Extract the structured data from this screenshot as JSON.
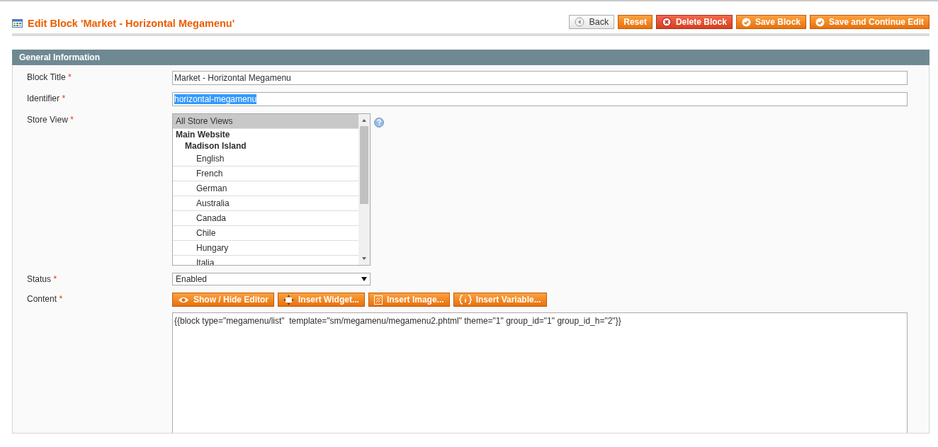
{
  "page_title": "Edit Block 'Market - Horizontal Megamenu'",
  "header_buttons": [
    {
      "kind": "back",
      "label": "Back"
    },
    {
      "kind": "plain",
      "label": "Reset"
    },
    {
      "kind": "delete",
      "label": "Delete Block"
    },
    {
      "kind": "save",
      "label": "Save Block"
    },
    {
      "kind": "save",
      "label": "Save and Continue Edit"
    }
  ],
  "section_title": "General Information",
  "fields": {
    "block_title": {
      "label": "Block Title",
      "required_mark": "*",
      "value": "Market - Horizontal Megamenu"
    },
    "identifier": {
      "label": "Identifier",
      "required_mark": "*",
      "value": "horizontal-megamenu",
      "text_selected": true
    },
    "store_view": {
      "label": "Store View",
      "required_mark": "*",
      "options": [
        {
          "label": "All Store Views",
          "selected": true
        },
        {
          "label": "Main Website",
          "selected": false,
          "children": [
            {
              "label": "Madison Island",
              "selected": false,
              "children": [
                {
                  "label": "English",
                  "selected": false
                },
                {
                  "label": "French",
                  "selected": false
                },
                {
                  "label": "German",
                  "selected": false
                },
                {
                  "label": "Australia",
                  "selected": false
                },
                {
                  "label": "Canada",
                  "selected": false
                },
                {
                  "label": "Chile",
                  "selected": false
                },
                {
                  "label": "Hungary",
                  "selected": false
                },
                {
                  "label": "Italia",
                  "selected": false
                }
              ]
            }
          ]
        }
      ]
    },
    "status": {
      "label": "Status",
      "required_mark": "*",
      "value": "Enabled"
    },
    "content": {
      "label": "Content",
      "required_mark": "*",
      "value": "{{block type=\"megamenu/list\"  template=\"sm/megamenu/megamenu2.phtml\" theme=\"1\" group_id=\"1\" group_id_h=\"2\"}}",
      "editor_buttons": [
        {
          "kind": "eye",
          "label": "Show / Hide Editor"
        },
        {
          "kind": "widget",
          "label": "Insert Widget..."
        },
        {
          "kind": "image",
          "label": "Insert Image..."
        },
        {
          "kind": "variable",
          "label": "Insert Variable..."
        }
      ]
    }
  }
}
